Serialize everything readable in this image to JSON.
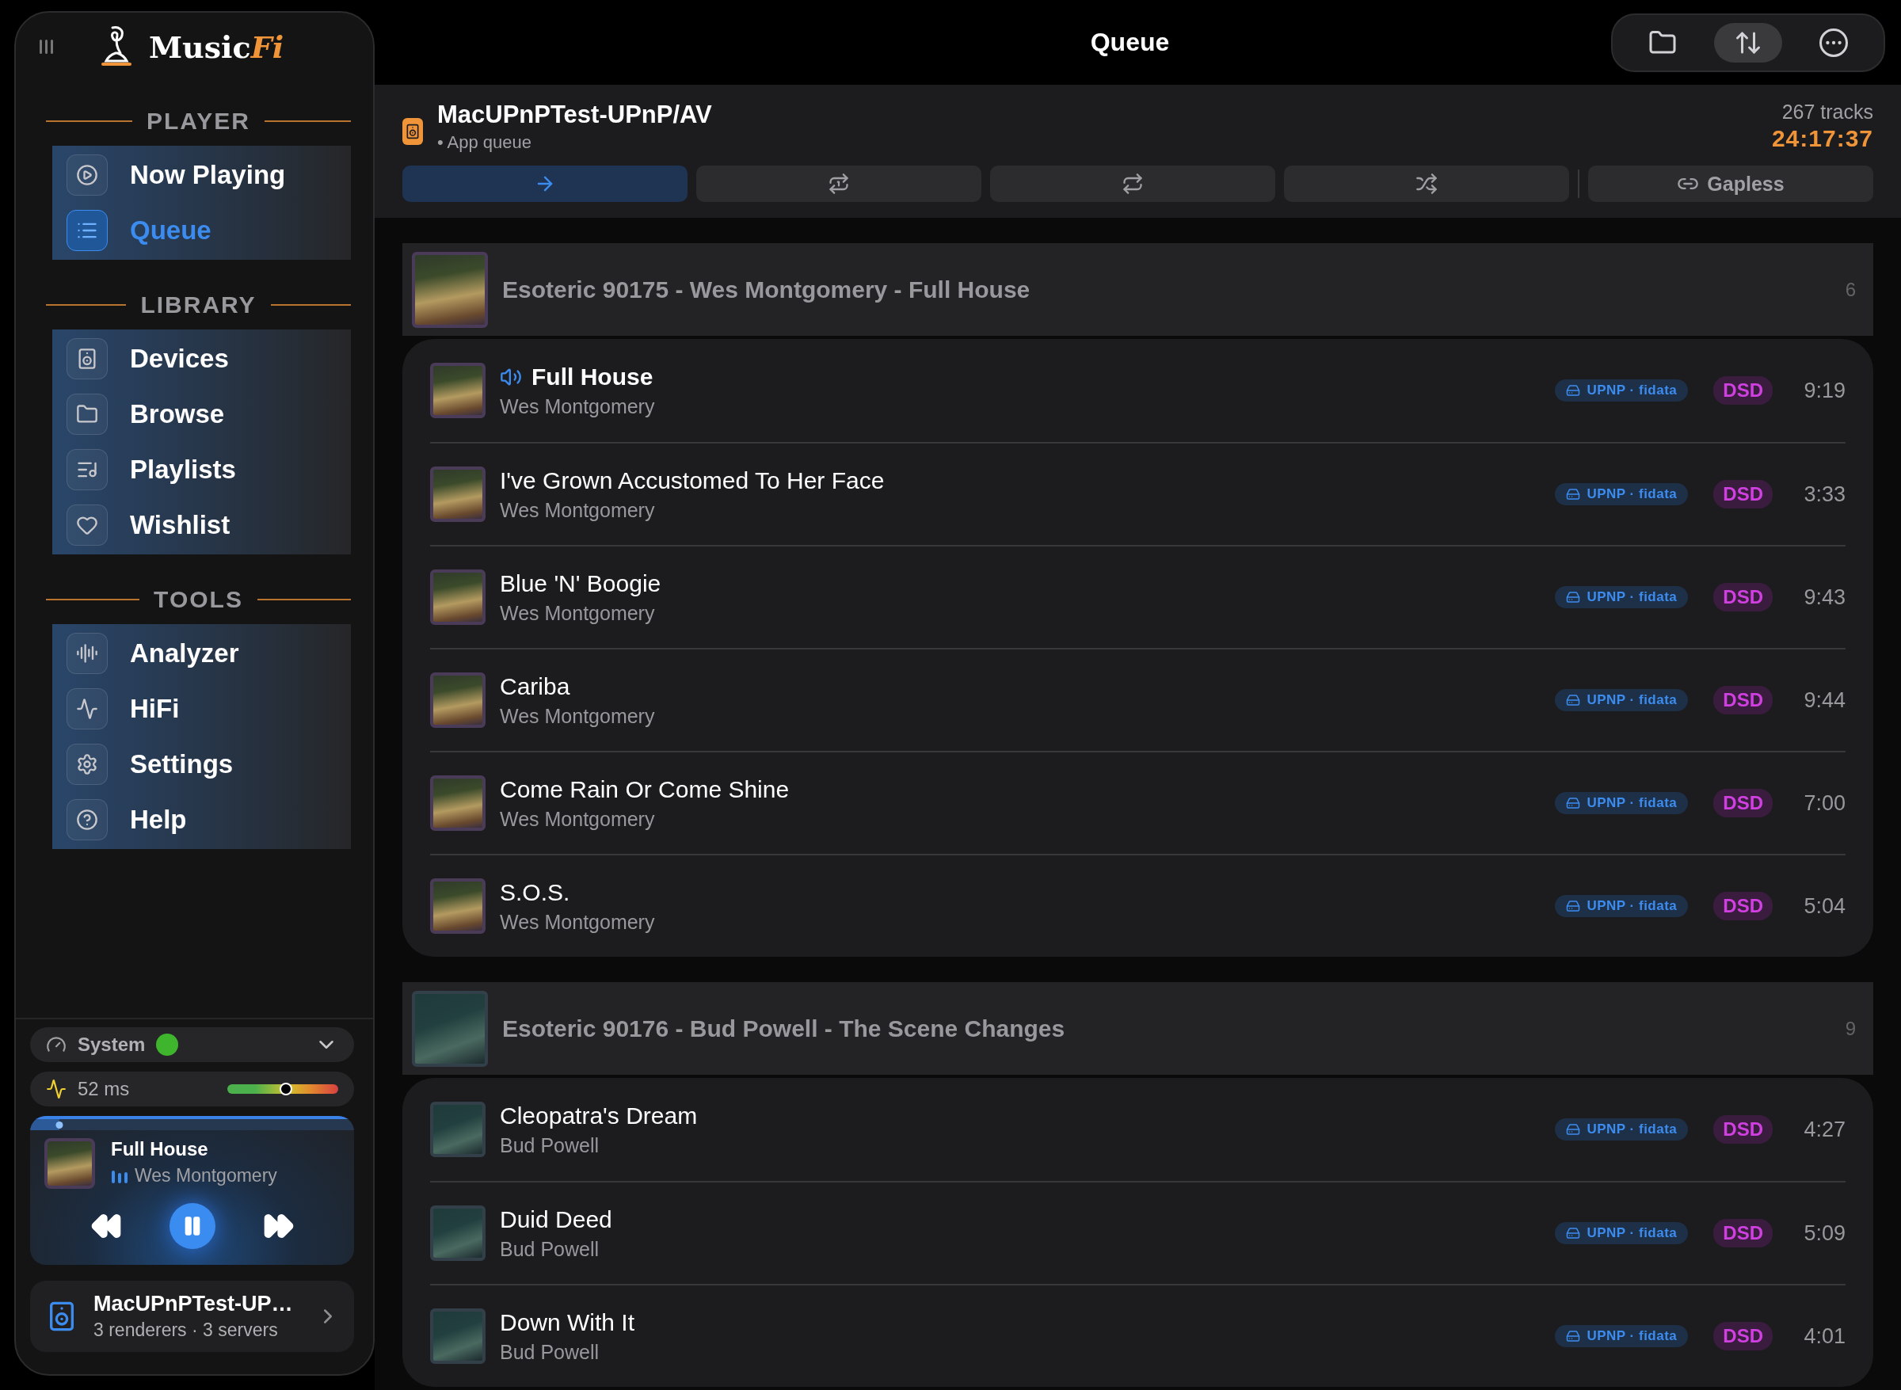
{
  "sidebar": {
    "logo": {
      "text": "Music",
      "accent": "Fi"
    },
    "sections": [
      {
        "title": "PLAYER",
        "items": [
          {
            "label": "Now Playing",
            "selected": false
          },
          {
            "label": "Queue",
            "selected": true
          }
        ]
      },
      {
        "title": "LIBRARY",
        "items": [
          {
            "label": "Devices",
            "selected": false
          },
          {
            "label": "Browse",
            "selected": false
          },
          {
            "label": "Playlists",
            "selected": false
          },
          {
            "label": "Wishlist",
            "selected": false
          }
        ]
      },
      {
        "title": "TOOLS",
        "items": [
          {
            "label": "Analyzer",
            "selected": false
          },
          {
            "label": "HiFi",
            "selected": false
          },
          {
            "label": "Settings",
            "selected": false
          },
          {
            "label": "Help",
            "selected": false
          }
        ]
      }
    ],
    "output": {
      "label": "System",
      "color": "#3fb52e"
    },
    "latency": {
      "reading": "52 ms",
      "level": 0.53
    },
    "now_playing": {
      "title": "Full House",
      "artist": "Wes Montgomery",
      "level": 0.09,
      "playing": true
    },
    "device": {
      "name": "MacUPnPTest-UP…",
      "detail": "3 renderers · 3 servers"
    }
  },
  "header": {
    "title": "Queue"
  },
  "queue": {
    "renderer": "MacUPnPTest-UPnP/AV",
    "source": "• App queue",
    "track_count": "267 tracks",
    "total_time": "24:17:37"
  },
  "modes": [
    {
      "selected": true
    },
    {
      "selected": false
    },
    {
      "selected": false
    },
    {
      "selected": false
    }
  ],
  "gapless": {
    "label": "Gapless",
    "selected": false
  },
  "groups": [
    {
      "title": "Esoteric 90175 - Wes Montgomery - Full House",
      "count": "6",
      "tracks": [
        {
          "title": "Full House",
          "artist": "Wes Montgomery",
          "source": "UPNP · fidata",
          "format": "DSD",
          "duration": "9:19",
          "playing": true
        },
        {
          "title": "I've Grown Accustomed To Her Face",
          "artist": "Wes Montgomery",
          "source": "UPNP · fidata",
          "format": "DSD",
          "duration": "3:33",
          "playing": false
        },
        {
          "title": "Blue 'N' Boogie",
          "artist": "Wes Montgomery",
          "source": "UPNP · fidata",
          "format": "DSD",
          "duration": "9:43",
          "playing": false
        },
        {
          "title": "Cariba",
          "artist": "Wes Montgomery",
          "source": "UPNP · fidata",
          "format": "DSD",
          "duration": "9:44",
          "playing": false
        },
        {
          "title": "Come Rain Or Come Shine",
          "artist": "Wes Montgomery",
          "source": "UPNP · fidata",
          "format": "DSD",
          "duration": "7:00",
          "playing": false
        },
        {
          "title": "S.O.S.",
          "artist": "Wes Montgomery",
          "source": "UPNP · fidata",
          "format": "DSD",
          "duration": "5:04",
          "playing": false
        }
      ]
    },
    {
      "title": "Esoteric 90176 - Bud Powell - The Scene Changes",
      "count": "9",
      "tracks": [
        {
          "title": "Cleopatra's Dream",
          "artist": "Bud Powell",
          "source": "UPNP · fidata",
          "format": "DSD",
          "duration": "4:27",
          "playing": false
        },
        {
          "title": "Duid Deed",
          "artist": "Bud Powell",
          "source": "UPNP · fidata",
          "format": "DSD",
          "duration": "5:09",
          "playing": false
        },
        {
          "title": "Down With It",
          "artist": "Bud Powell",
          "source": "UPNP · fidata",
          "format": "DSD",
          "duration": "4:01",
          "playing": false
        }
      ]
    }
  ]
}
